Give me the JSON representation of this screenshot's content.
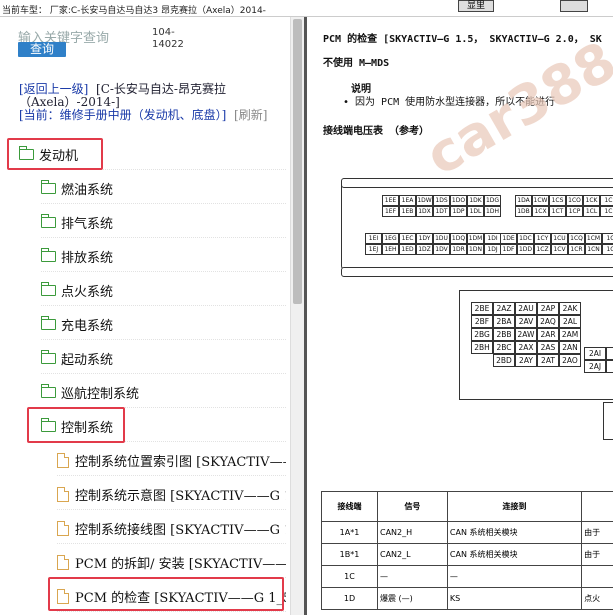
{
  "header": {
    "car_model": "当前车型： 厂家:C-长安马自达马自达3 昂克赛拉（Axela）2014-",
    "btn1": "显里",
    "btn2": ""
  },
  "search": {
    "placeholder": "输入关键字查询",
    "button": "查询",
    "code": "104-14022"
  },
  "breadcrumb": {
    "back": "[返回上一级]",
    "vehicle": "[C-长安马自达-昂克赛拉（Axela）-2014-]",
    "current": "[当前：维修手册中册（发动机、底盘）]",
    "refresh": "[刷新]"
  },
  "tree": [
    {
      "label": "发动机",
      "type": "folder",
      "level": 0
    },
    {
      "label": "燃油系统",
      "type": "folder",
      "level": 1
    },
    {
      "label": "排气系统",
      "type": "folder",
      "level": 1
    },
    {
      "label": "排放系统",
      "type": "folder",
      "level": 1
    },
    {
      "label": "点火系统",
      "type": "folder",
      "level": 1
    },
    {
      "label": "充电系统",
      "type": "folder",
      "level": 1
    },
    {
      "label": "起动系统",
      "type": "folder",
      "level": 1
    },
    {
      "label": "巡航控制系统",
      "type": "folder",
      "level": 1
    },
    {
      "label": "控制系统",
      "type": "folder",
      "level": 1
    },
    {
      "label": "控制系统位置索引图 [SKYACTIV——",
      "type": "doc",
      "level": 2
    },
    {
      "label": "控制系统示意图 [SKYACTIV——G 1_",
      "type": "doc",
      "level": 2
    },
    {
      "label": "控制系统接线图 [SKYACTIV——G 1_",
      "type": "doc",
      "level": 2
    },
    {
      "label": "PCM 的拆卸/ 安装 [SKYACTIV——G",
      "type": "doc",
      "level": 2
    },
    {
      "label": "PCM 的检查 [SKYACTIV——G 1_5，",
      "type": "doc",
      "level": 2
    }
  ],
  "document": {
    "title": "PCM 的检查 [SKYACTIV—G 1.5， SKYACTIV—G 2.0， SK",
    "subtitle": "不使用 M—MDS",
    "note_heading": "说明",
    "note_body": "• 因为 PCM 使用防水型连接器，所以不能进行",
    "section": "接线端电压表 （参考）",
    "pins_row1": [
      "1EE",
      "1EA",
      "1DW",
      "1DS",
      "1DO",
      "1DK",
      "1DG"
    ],
    "pins_row2": [
      "1EF",
      "1EB",
      "1DX",
      "1DT",
      "1DP",
      "1DL",
      "1DH"
    ],
    "pins_row1b": [
      "1DA",
      "1CW",
      "1CS",
      "1CO",
      "1CK",
      "1C"
    ],
    "pins_row2b": [
      "1DB",
      "1CX",
      "1CT",
      "1CP",
      "1CL",
      "1C"
    ],
    "pins_row3": [
      "1EI",
      "1EG",
      "1EC",
      "1DY",
      "1DU",
      "1DQ",
      "1DM",
      "1DI"
    ],
    "pins_row4": [
      "1EJ",
      "1EH",
      "1ED",
      "1DZ",
      "1DV",
      "1DR",
      "1DN",
      "1DJ"
    ],
    "pins_row3b": [
      "1DE",
      "1DC",
      "1CY",
      "1CU",
      "1CQ",
      "1CM",
      "1C"
    ],
    "pins_row4b": [
      "1DF",
      "1DD",
      "1CZ",
      "1CV",
      "1CR",
      "1CN",
      "1C"
    ],
    "pins2": [
      [
        "2BE",
        "2AZ",
        "2AU",
        "2AP",
        "2AK"
      ],
      [
        "2BF",
        "2BA",
        "2AV",
        "2AQ",
        "2AL"
      ],
      [
        "2BG",
        "2BB",
        "2AW",
        "2AR",
        "2AM"
      ],
      [
        "2BH",
        "2BC",
        "2AX",
        "2AS",
        "2AN"
      ],
      [
        "",
        "2BD",
        "2AY",
        "2AT",
        "2AO"
      ]
    ],
    "pins2b": [
      [
        "2AI",
        "2"
      ],
      [
        "2AJ",
        "2"
      ]
    ],
    "table_headers": [
      "接线端",
      "信号",
      "连接到",
      ""
    ],
    "table_rows": [
      [
        "1A*1",
        "CAN2_H",
        "CAN 系统相关模块",
        "由于"
      ],
      [
        "1B*1",
        "CAN2_L",
        "CAN 系统相关模块",
        "由于"
      ],
      [
        "1C",
        "—",
        "—",
        ""
      ],
      [
        "1D",
        "爆震 (—)",
        "KS",
        "点火"
      ]
    ],
    "watermark": "car388"
  }
}
